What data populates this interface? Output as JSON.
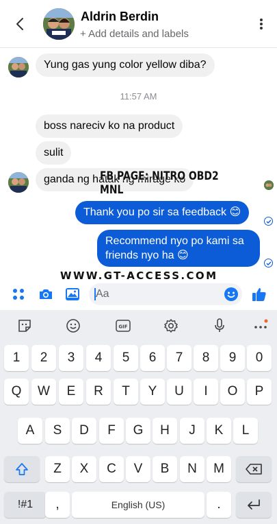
{
  "header": {
    "contact_name": "Aldrin Berdin",
    "subtitle": "+ Add details and labels",
    "avatar_badge": "DIRECT"
  },
  "messages": {
    "m1": "Yung gas yung color yellow diba?",
    "time": "11:57 AM",
    "m2": "boss nareciv ko na product",
    "m3": "sulit",
    "m4": "ganda ng hatak ng mirage ko",
    "r1": "Thank you po sir sa feedback 😊",
    "r2_line1": "Recommend nyo po kami sa",
    "r2_line2": "friends nyo ha 😊"
  },
  "overlay": {
    "fb_page": "FB PAGE: NITRO OBD2 MNL",
    "website": "WWW.GT-ACCESS.COM"
  },
  "composer": {
    "placeholder": "Aa"
  },
  "keyboard": {
    "row_numbers": [
      "1",
      "2",
      "3",
      "4",
      "5",
      "6",
      "7",
      "8",
      "9",
      "0"
    ],
    "row_top": [
      "Q",
      "W",
      "E",
      "R",
      "T",
      "Y",
      "U",
      "I",
      "O",
      "P"
    ],
    "row_mid": [
      "A",
      "S",
      "D",
      "F",
      "G",
      "H",
      "J",
      "K",
      "L"
    ],
    "row_bottom": [
      "Z",
      "X",
      "C",
      "V",
      "B",
      "N",
      "M"
    ],
    "symbols_key": "!#1",
    "comma_key": ",",
    "space_label": "English (US)",
    "period_key": ".",
    "gif_label": "GIF"
  },
  "colors": {
    "accent": "#0b5cd6",
    "messenger_blue": "#1877f2",
    "incoming_bubble": "#f0f0f0",
    "keyboard_bg": "#eceef1"
  }
}
